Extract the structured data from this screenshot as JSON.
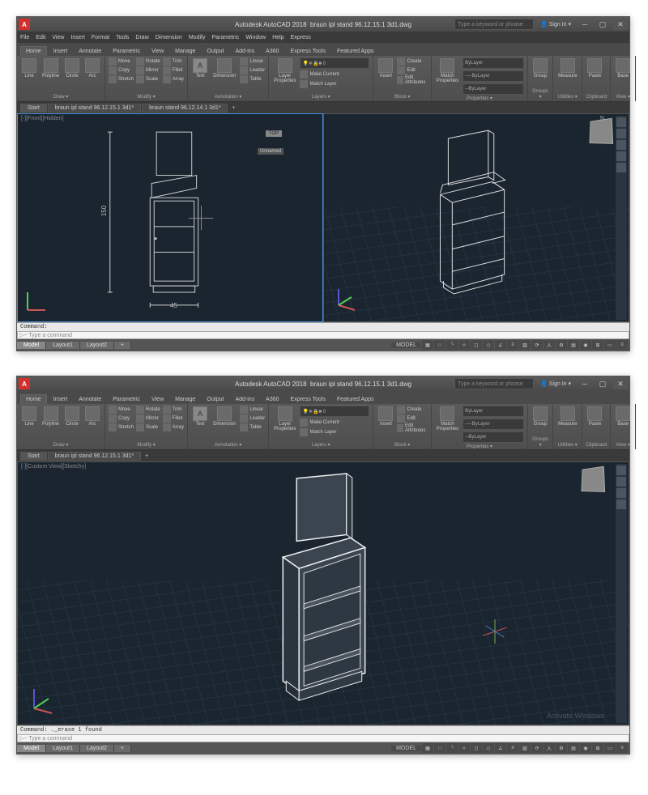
{
  "app": {
    "name": "Autodesk AutoCAD 2018",
    "filename": "braun ipl stand 96.12.15.1 3d1.dwg",
    "search_placeholder": "Type a keyword or phrase",
    "signin": "Sign In"
  },
  "menus": [
    "File",
    "Edit",
    "View",
    "Insert",
    "Format",
    "Tools",
    "Draw",
    "Dimension",
    "Modify",
    "Parametric",
    "Window",
    "Help",
    "Express"
  ],
  "ribbon_tabs": [
    "Home",
    "Insert",
    "Annotate",
    "Parametric",
    "View",
    "Manage",
    "Output",
    "Add-ins",
    "A360",
    "Express Tools",
    "Featured Apps"
  ],
  "ribbon": {
    "draw": {
      "label": "Draw ▾",
      "items": [
        "Line",
        "Polyline",
        "Circle",
        "Arc"
      ]
    },
    "modify": {
      "label": "Modify ▾",
      "items": [
        "Move",
        "Rotate",
        "Trim",
        "Copy",
        "Mirror",
        "Fillet",
        "Stretch",
        "Scale",
        "Array"
      ]
    },
    "annotation": {
      "label": "Annotation ▾",
      "items": [
        "Text",
        "Dimension",
        "Linear",
        "Leader",
        "Table"
      ]
    },
    "layers": {
      "label": "Layers ▾",
      "items": [
        "Layer Properties",
        "Make Current",
        "Match Layer"
      ]
    },
    "block": {
      "label": "Block ▾",
      "items": [
        "Insert",
        "Create",
        "Edit",
        "Edit Attributes"
      ]
    },
    "properties": {
      "label": "Properties ▾",
      "items": [
        "Match Properties"
      ],
      "bylayer": "ByLayer"
    },
    "groups": {
      "label": "Groups ▾",
      "item": "Group"
    },
    "utilities": {
      "label": "Utilities ▾",
      "item": "Measure"
    },
    "clipboard": {
      "label": "Clipboard",
      "item": "Paste"
    },
    "view": {
      "label": "View ▾",
      "item": "Base"
    }
  },
  "doc_tabs": {
    "start": "Start",
    "file1": "braun ipl stand 96.12.15.1 3d1*",
    "file2": "braun stand 96.12.14.1 3d1*"
  },
  "viewport": {
    "front_label": "[-][Front][Hidden]",
    "custom_label": "[-][Custom View][Sketchy]",
    "top_badge": "TOP",
    "unnamed": "Unnamed",
    "dimensions": {
      "height": "150",
      "width": "45"
    },
    "cube_n": "N"
  },
  "command": {
    "history1": "Command:",
    "history2": "Command: ._erase 1 found",
    "prompt": "▷~ Type a command"
  },
  "layout_tabs": [
    "Model",
    "Layout1",
    "Layout2"
  ],
  "status": {
    "model": "MODEL"
  },
  "watermark": "Activate Windows"
}
